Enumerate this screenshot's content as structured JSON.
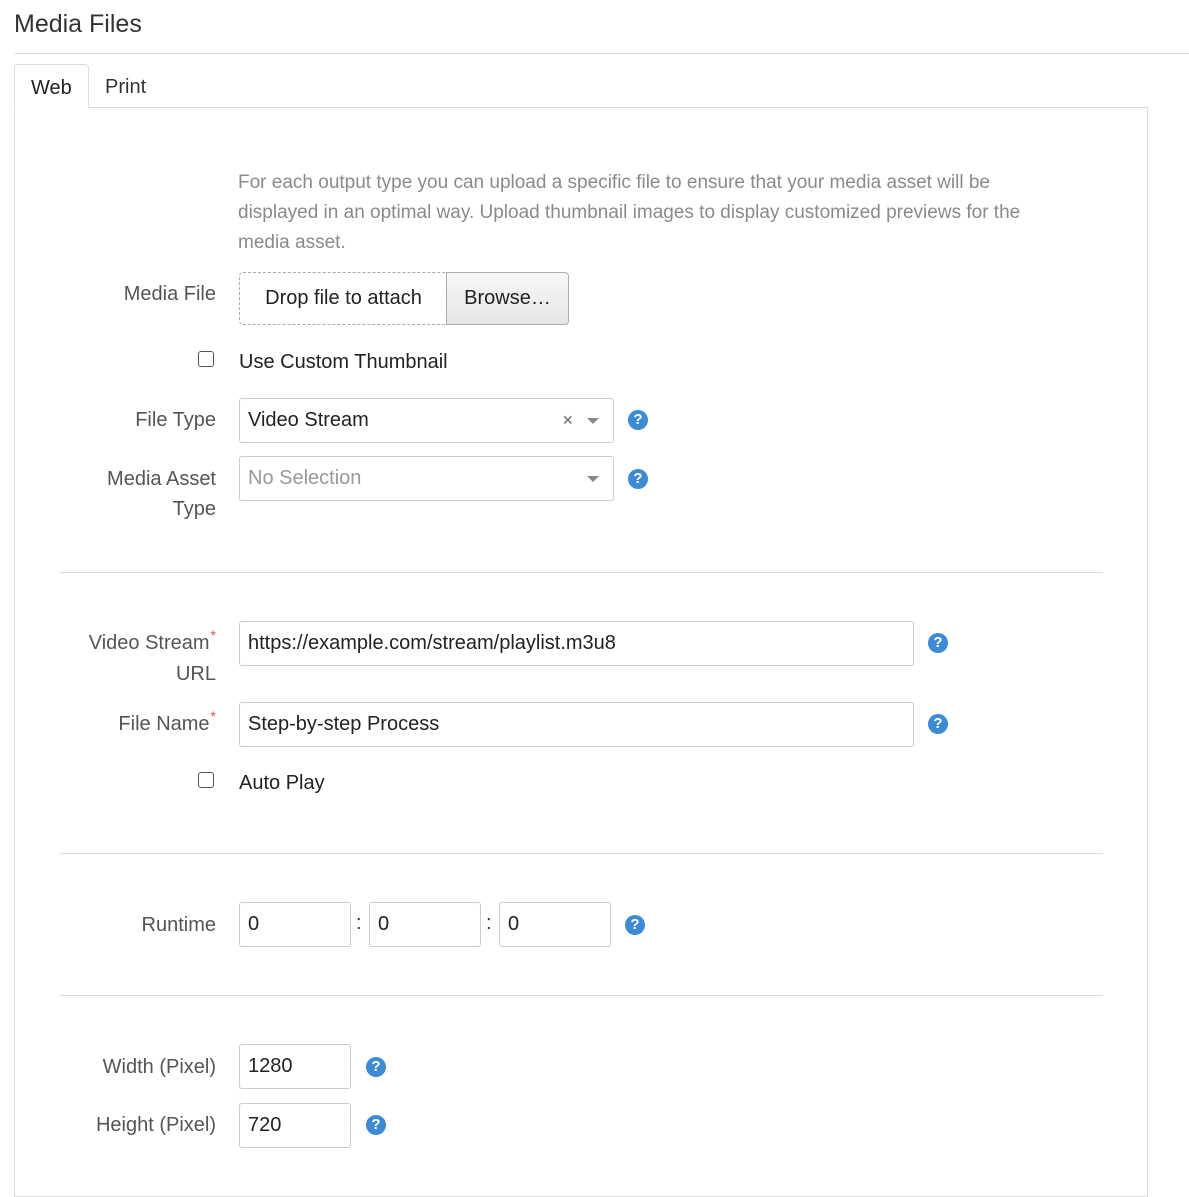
{
  "page": {
    "title": "Media Files"
  },
  "tabs": [
    {
      "label": "Web",
      "active": true
    },
    {
      "label": "Print",
      "active": false
    }
  ],
  "intro": "For each output type you can upload a specific file to ensure that your media asset will be displayed in an optimal way. Upload thumbnail images to display customized previews for the media asset.",
  "media_file": {
    "label": "Media File",
    "drop_text": "Drop file to attach",
    "browse_label": "Browse…"
  },
  "custom_thumbnail": {
    "label": "Use Custom Thumbnail",
    "checked": false
  },
  "file_type": {
    "label": "File Type",
    "value": "Video Stream",
    "clear_glyph": "×"
  },
  "media_asset_type": {
    "label_line1": "Media Asset",
    "label_line2": "Type",
    "placeholder": "No Selection"
  },
  "video_stream_url": {
    "label_line1": "Video Stream",
    "label_line2": "URL",
    "required_mark": "*",
    "value": "https://example.com/stream/playlist.m3u8"
  },
  "file_name": {
    "label": "File Name",
    "required_mark": "*",
    "value": "Step-by-step Process"
  },
  "auto_play": {
    "label": "Auto Play",
    "checked": false
  },
  "runtime": {
    "label": "Runtime",
    "hours": "0",
    "minutes": "0",
    "seconds": "0",
    "separator": ":"
  },
  "width": {
    "label": "Width (Pixel)",
    "value": "1280"
  },
  "height": {
    "label": "Height (Pixel)",
    "value": "720"
  },
  "help_glyph": "?",
  "colors": {
    "accent": "#3d8bd4",
    "required": "#d9534f"
  }
}
